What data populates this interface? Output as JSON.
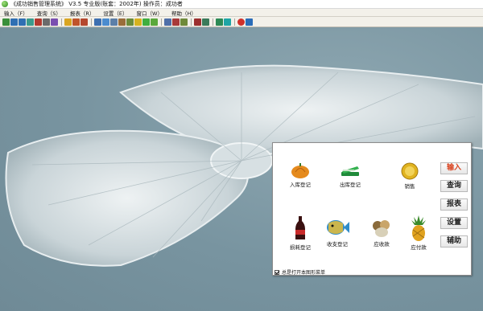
{
  "window": {
    "title": "《成功销售管理系统》 V3.5 专业版(账套：2002年) 操作员：成功者"
  },
  "menu": [
    {
      "label": "输入（F）"
    },
    {
      "label": "查询（S）"
    },
    {
      "label": "报表（R）"
    },
    {
      "label": "设置（E）"
    },
    {
      "label": "窗口（W）"
    },
    {
      "label": "帮助（H）"
    }
  ],
  "toolbar": {
    "icons": [
      "open-icon",
      "back-icon",
      "forward-icon",
      "refresh-icon",
      "stop-icon",
      "print-icon",
      "save-icon",
      "folder-icon",
      "cut-icon",
      "person-icon",
      "doc-icon",
      "find-icon",
      "table-icon",
      "edit-icon",
      "list-icon",
      "coin-icon",
      "gear-icon",
      "settings-icon",
      "chart-icon",
      "report-icon",
      "graph-icon",
      "shield-icon",
      "user-icon",
      "window-icon",
      "grid-icon",
      "apple-icon",
      "help-icon"
    ]
  },
  "panel": {
    "functions": [
      {
        "label": "入库登记",
        "icon": "pumpkin-icon"
      },
      {
        "label": "出库登记",
        "icon": "stapler-icon"
      },
      {
        "label": "销售",
        "icon": "gold-coin-icon"
      },
      {
        "label": "损耗登记",
        "icon": "cola-bottle-icon"
      },
      {
        "label": "收支登记",
        "icon": "fish-icon"
      },
      {
        "label": "应收款",
        "icon": "nuts-icon"
      },
      {
        "label": "应付款",
        "icon": "pineapple-icon"
      }
    ],
    "side_buttons": [
      {
        "label": "输入",
        "active": true
      },
      {
        "label": "查询",
        "active": false
      },
      {
        "label": "报表",
        "active": false
      },
      {
        "label": "设置",
        "active": false
      },
      {
        "label": "辅助",
        "active": false
      }
    ],
    "footer_checkbox": {
      "label": "总是打开本图形菜单",
      "checked": true
    }
  },
  "colors": {
    "desktop": "#7e9aa6",
    "menu_bg": "#f3f1ea",
    "active_button_text": "#d8401c"
  }
}
